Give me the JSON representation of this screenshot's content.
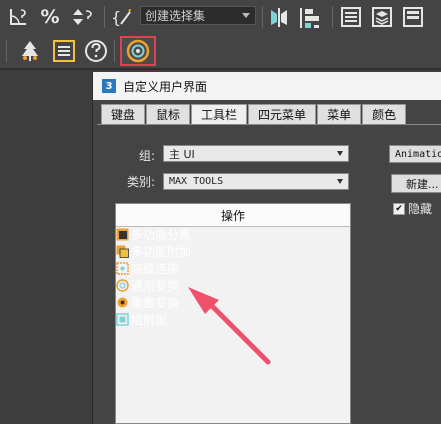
{
  "toolbar": {
    "selection_set_placeholder": "创建选择集",
    "icons_row1": [
      "snap-angle-icon",
      "percent-snap-icon",
      "spinner-snap-icon",
      "edit-named-selection-icon",
      "mirror-icon",
      "align-icon",
      "layer-manager-icon",
      "scene-explorer-icon"
    ],
    "icons_row2": [
      "populate-icon",
      "list-icon",
      "help-icon",
      "universal-transform-icon"
    ]
  },
  "dialog": {
    "title_num": "3",
    "title": "自定义用户界面",
    "tabs": [
      "键盘",
      "鼠标",
      "工具栏",
      "四元菜单",
      "菜单",
      "颜色"
    ],
    "active_tab": 2,
    "group_label": "组:",
    "group_value": "主 UI",
    "category_label": "类别:",
    "category_value": "MAX TOOLS",
    "action_header": "操作",
    "right_dropdown_value": "Animatio",
    "new_button": "新建...",
    "hide_checkbox": "隐藏",
    "items": [
      "多功能分离",
      "多功能附加",
      "高级连接",
      "通用变换",
      "重置变换",
      "组附加"
    ]
  },
  "colors": {
    "highlight_border": "#e0414f",
    "annotation_arrow": "#f0506a"
  }
}
